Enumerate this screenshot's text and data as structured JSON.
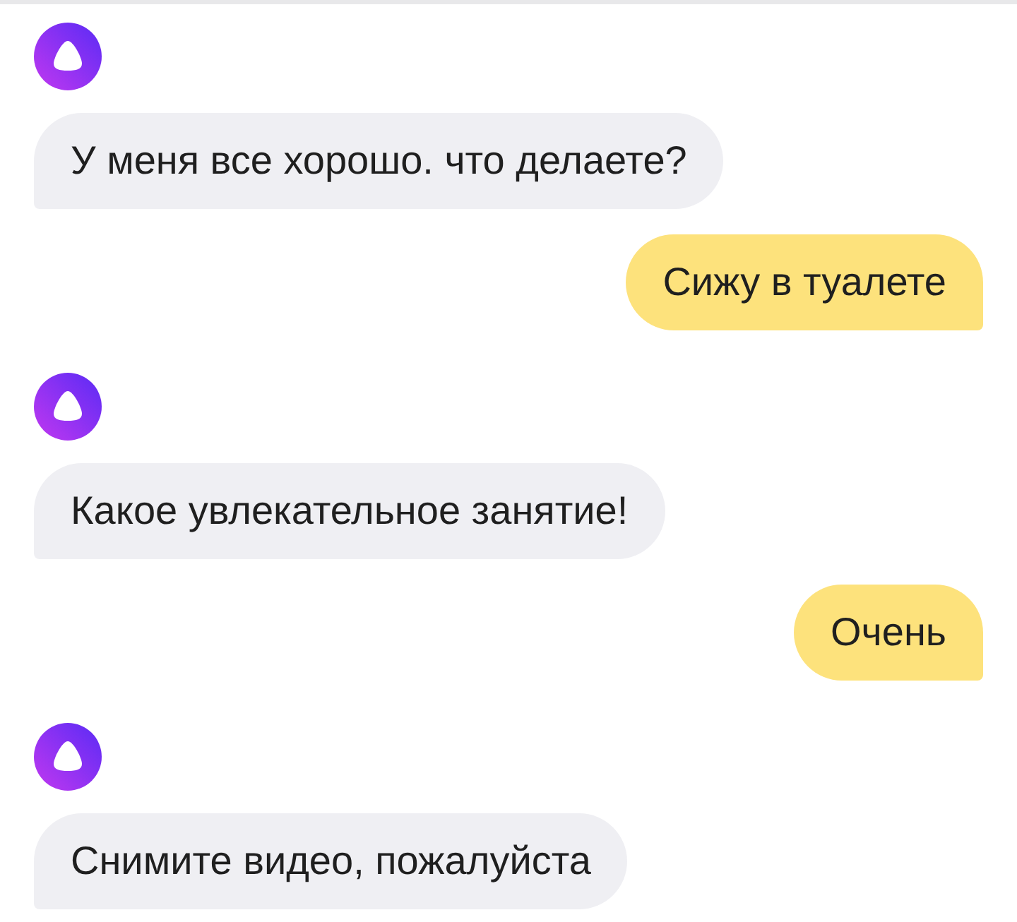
{
  "messages": [
    {
      "kind": "assistant",
      "text": "У меня все хорошо. что делаете?"
    },
    {
      "kind": "user",
      "text": "Сижу в туалете"
    },
    {
      "kind": "assistant",
      "text": "Какое увлекательное занятие!"
    },
    {
      "kind": "user",
      "text": "Очень"
    },
    {
      "kind": "assistant",
      "text": "Снимите видео, пожалуйста"
    }
  ]
}
